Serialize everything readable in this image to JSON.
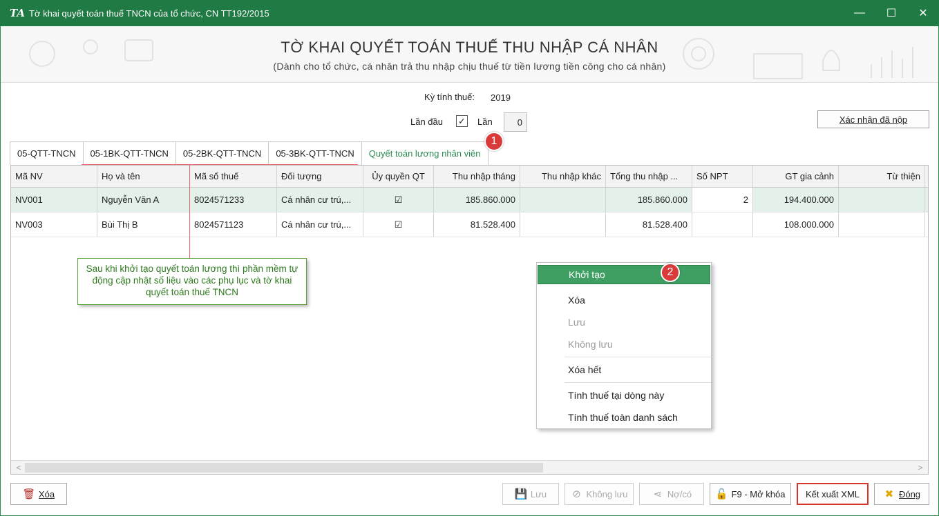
{
  "window": {
    "app_icon": "TA",
    "title": "Tờ khai quyết toán thuế TNCN của tổ chức, CN  TT192/2015",
    "minimize": "—",
    "maximize": "☐",
    "close": "✕"
  },
  "header": {
    "title": "TỜ KHAI QUYẾT TOÁN THUẾ THU NHẬP CÁ NHÂN",
    "subtitle": "(Dành cho tổ chức, cá nhân trả thu nhập chịu thuế từ tiền lương tiền công cho cá nhân)"
  },
  "form": {
    "period_label": "Kỳ tính thuế:",
    "period_value": "2019",
    "first_time_label": "Lần đầu",
    "first_time_checked": "✓",
    "times_label": "Lần",
    "times_value": "0",
    "confirm_button": "Xác nhận đã nộp"
  },
  "tabs": [
    {
      "label": "05-QTT-TNCN"
    },
    {
      "label": "05-1BK-QTT-TNCN"
    },
    {
      "label": "05-2BK-QTT-TNCN"
    },
    {
      "label": "05-3BK-QTT-TNCN"
    },
    {
      "label": "Quyết toán lương nhân viên"
    }
  ],
  "grid": {
    "columns": [
      "Mã NV",
      "Họ và tên",
      "Mã số thuế",
      "Đối tượng",
      "Ủy quyền QT",
      "Thu nhập tháng",
      "Thu nhập khác",
      "Tổng thu nhập ...",
      "Số NPT",
      "GT gia cảnh",
      "Từ thiện"
    ],
    "rows": [
      {
        "ma_nv": "NV001",
        "ho_ten": "Nguyễn Văn A",
        "mst": "8024571233",
        "doi_tuong": "Cá nhân cư trú,...",
        "uy_quyen": "☑",
        "thu_nhap_thang": "185.860.000",
        "thu_nhap_khac": "",
        "tong_thu_nhap": "185.860.000",
        "so_npt": "2",
        "gt_gia_canh": "194.400.000",
        "tu_thien": ""
      },
      {
        "ma_nv": "NV003",
        "ho_ten": "Bùi Thị B",
        "mst": "8024571123",
        "doi_tuong": "Cá nhân cư trú,...",
        "uy_quyen": "☑",
        "thu_nhap_thang": "81.528.400",
        "thu_nhap_khac": "",
        "tong_thu_nhap": "81.528.400",
        "so_npt": "",
        "gt_gia_canh": "108.000.000",
        "tu_thien": ""
      }
    ]
  },
  "hint": "Sau khi khởi tạo quyết toán lương thì phần mềm tự động cập nhật số liệu vào các phụ lục và tờ khai quyết toán thuế TNCN",
  "badges": {
    "one": "1",
    "two": "2"
  },
  "context_menu": {
    "items": [
      "Khởi tạo",
      "Xóa",
      "Lưu",
      "Không lưu",
      "Xóa hết",
      "Tính thuế tại dòng này",
      "Tính thuế toàn danh sách"
    ]
  },
  "buttons": {
    "delete": "Xóa",
    "save": "Lưu",
    "discard": "Không lưu",
    "debt": "Nợ/có",
    "unlock": "F9 - Mở khóa",
    "export_xml": "Kết xuất XML",
    "close": "Đóng"
  },
  "scroll": {
    "left": "<",
    "right": ">"
  }
}
